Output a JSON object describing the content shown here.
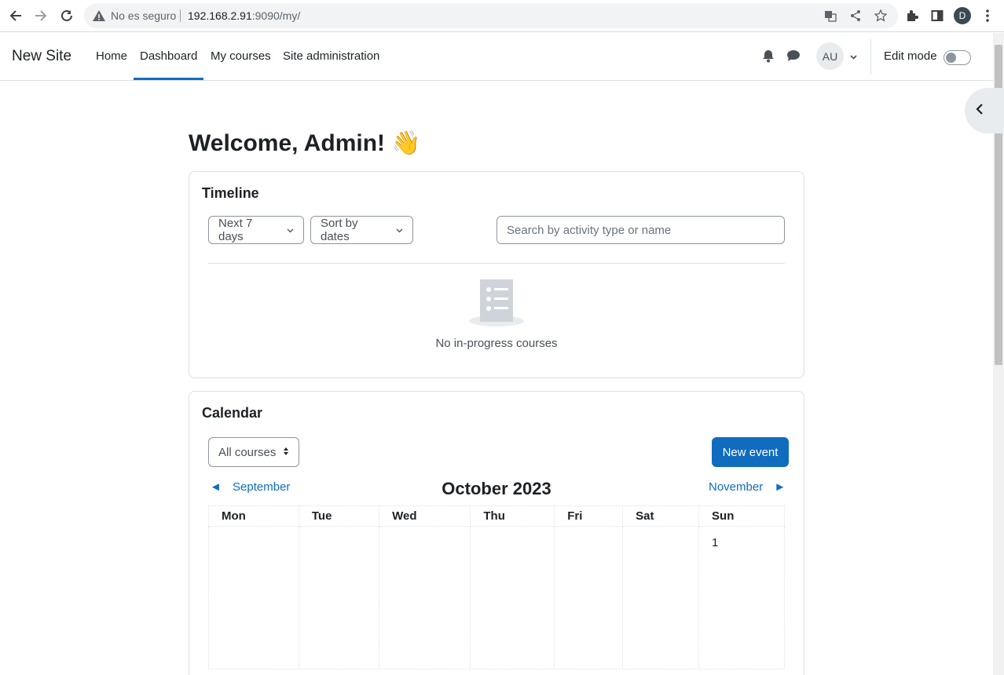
{
  "browser": {
    "insecure_label": "No es seguro",
    "url_host": "192.168.2.91",
    "url_path": ":9090/my/",
    "profile_initial": "D"
  },
  "navbar": {
    "brand": "New Site",
    "links": [
      "Home",
      "Dashboard",
      "My courses",
      "Site administration"
    ],
    "active_link": "Dashboard",
    "avatar_initials": "AU",
    "edit_mode_label": "Edit mode",
    "edit_mode_on": false
  },
  "page": {
    "welcome": "Welcome, Admin! 👋"
  },
  "timeline": {
    "title": "Timeline",
    "filter_label": "Next 7 days",
    "sort_label": "Sort by dates",
    "search_placeholder": "Search by activity type or name",
    "empty_text": "No in-progress courses"
  },
  "calendar": {
    "title": "Calendar",
    "course_select": "All courses",
    "new_event_label": "New event",
    "prev_month": "September",
    "current_month": "October 2023",
    "next_month": "November",
    "weekdays": [
      "Mon",
      "Tue",
      "Wed",
      "Thu",
      "Fri",
      "Sat",
      "Sun"
    ],
    "first_week": [
      "",
      "",
      "",
      "",
      "",
      "",
      "1"
    ]
  },
  "colors": {
    "primary": "#0f6cbf",
    "text": "#1d2125"
  }
}
